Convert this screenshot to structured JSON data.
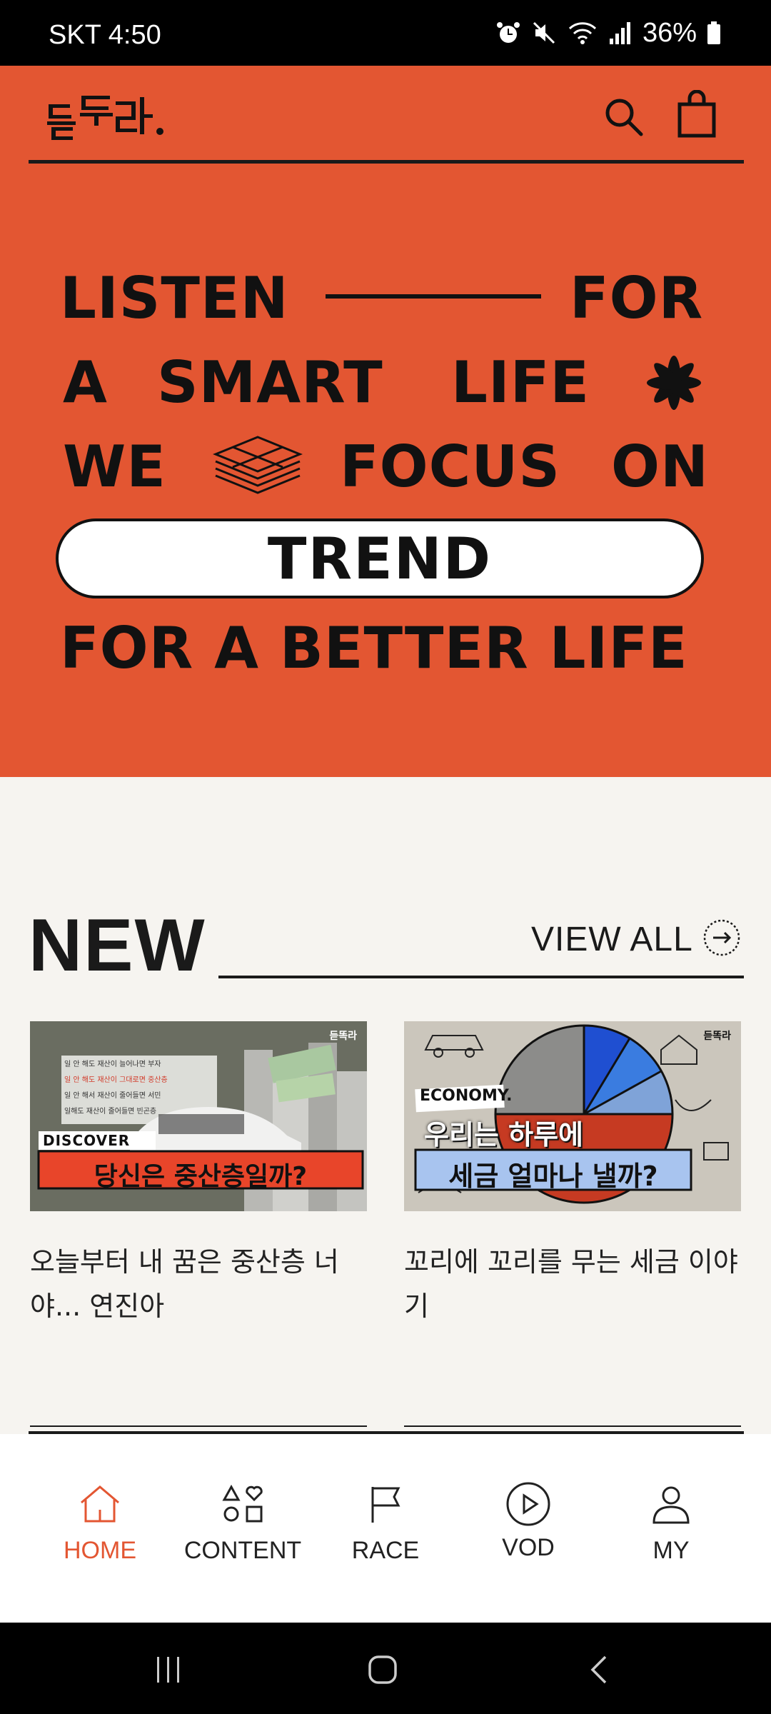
{
  "status_bar": {
    "carrier_time": "SKT 4:50",
    "battery": "36%"
  },
  "header": {
    "logo_text": "듣똑라",
    "icons": [
      "search-icon",
      "shopping-bag-icon"
    ]
  },
  "hero": {
    "line1_left": "LISTEN",
    "line1_right": "FOR",
    "line2_a": "A",
    "line2_b": "SMART",
    "line2_c": "LIFE",
    "line3_a": "WE",
    "line3_b": "FOCUS",
    "line3_c": "ON",
    "pill": "TREND",
    "line5": "FOR A BETTER LIFE",
    "color": "#E35632"
  },
  "new_section": {
    "title": "NEW",
    "view_all": "VIEW ALL",
    "cards": [
      {
        "title": "오늘부터 내 꿈은 중산층 너야... 연진아",
        "thumb_tag": "DISCOVER",
        "thumb_headline": "당신은 중산층일까?",
        "thumb_lines": [
          "일 안 해도 재산이 늘어나면 부자",
          "일 안 해도 재산이 그대로면 중산층",
          "일 안 해서 재산이 줄어들면 서민",
          "일해도 재산이 줄어들면 빈곤층"
        ],
        "thumb_logo": "듣똑라"
      },
      {
        "title": "꼬리에 꼬리를 무는 세금 이야기",
        "thumb_tag": "ECONOMY.",
        "thumb_headline_1": "우리는 하루에",
        "thumb_headline_2": "세금 얼마나 낼까?",
        "thumb_logo": "듣똑라"
      }
    ]
  },
  "bottom_nav": {
    "items": [
      {
        "label": "HOME",
        "icon": "home-icon",
        "active": true
      },
      {
        "label": "CONTENT",
        "icon": "shapes-icon",
        "active": false
      },
      {
        "label": "RACE",
        "icon": "flag-icon",
        "active": false
      },
      {
        "label": "VOD",
        "icon": "play-circle-icon",
        "active": false
      },
      {
        "label": "MY",
        "icon": "user-icon",
        "active": false
      }
    ],
    "active_color": "#E35632"
  }
}
